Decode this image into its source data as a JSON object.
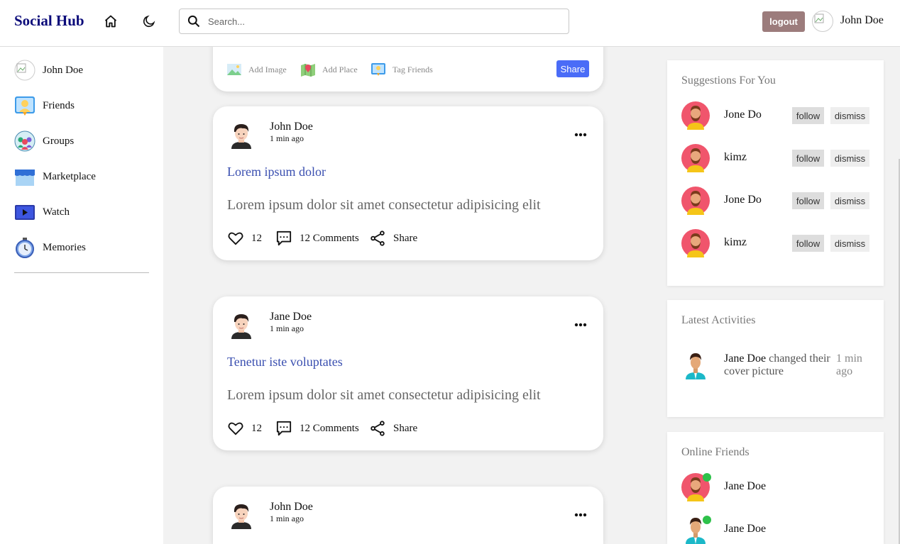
{
  "header": {
    "brand": "Social Hub",
    "search_placeholder": "Search...",
    "logout_label": "logout",
    "user_name": "John Doe"
  },
  "sidebar": {
    "items": [
      {
        "label": "John Doe",
        "icon": "user-avatar"
      },
      {
        "label": "Friends",
        "icon": "friends-icon"
      },
      {
        "label": "Groups",
        "icon": "groups-icon"
      },
      {
        "label": "Marketplace",
        "icon": "marketplace-icon"
      },
      {
        "label": "Watch",
        "icon": "watch-icon"
      },
      {
        "label": "Memories",
        "icon": "memories-icon"
      }
    ]
  },
  "composer": {
    "add_image": "Add Image",
    "add_place": "Add Place",
    "tag_friends": "Tag Friends",
    "share_label": "Share"
  },
  "posts": [
    {
      "author": "John Doe",
      "time": "1 min ago",
      "title": "Lorem ipsum dolor",
      "body": "Lorem ipsum dolor sit amet consectetur adipisicing elit",
      "likes": "12",
      "comments": "12 Comments",
      "share": "Share"
    },
    {
      "author": "Jane Doe",
      "time": "1 min ago",
      "title": "Tenetur iste voluptates",
      "body": "Lorem ipsum dolor sit amet consectetur adipisicing elit",
      "likes": "12",
      "comments": "12 Comments",
      "share": "Share"
    },
    {
      "author": "John Doe",
      "time": "1 min ago"
    }
  ],
  "suggestions": {
    "title": "Suggestions For You",
    "follow_label": "follow",
    "dismiss_label": "dismiss",
    "people": [
      {
        "name": "Jone Do"
      },
      {
        "name": "kimz"
      },
      {
        "name": "Jone Do"
      },
      {
        "name": "kimz"
      }
    ]
  },
  "activities": {
    "title": "Latest Activities",
    "items": [
      {
        "who": "Jane Doe",
        "what": " changed their cover picture",
        "time": "1 min ago"
      }
    ]
  },
  "online": {
    "title": "Online Friends",
    "friends": [
      {
        "name": "Jane Doe"
      },
      {
        "name": "Jane Doe"
      }
    ]
  },
  "colors": {
    "brand": "#0b0b7a",
    "logout_bg": "#9c7c7c",
    "share_bg": "#4a6cf7",
    "post_title": "#3a4fb0",
    "online": "#2ec14a"
  }
}
